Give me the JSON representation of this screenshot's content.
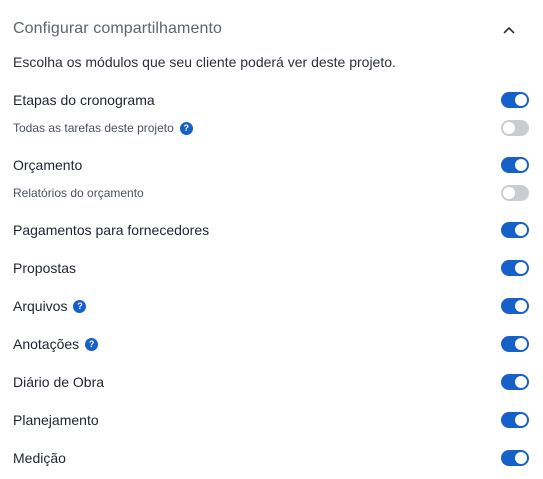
{
  "header": {
    "title": "Configurar compartilhamento",
    "collapse_icon": "chevron-up-icon"
  },
  "description": "Escolha os módulos que seu cliente poderá ver deste projeto.",
  "colors": {
    "toggle_on": "#1660c9",
    "toggle_off": "#c9ccd1",
    "help_icon": "#1660c9"
  },
  "modules": [
    {
      "label": "Etapas do cronograma",
      "enabled": true,
      "help": false,
      "level": "main"
    },
    {
      "label": "Todas as tarefas deste projeto",
      "enabled": false,
      "help": true,
      "level": "sub"
    },
    {
      "label": "Orçamento",
      "enabled": true,
      "help": false,
      "level": "main"
    },
    {
      "label": "Relatórios do orçamento",
      "enabled": false,
      "help": false,
      "level": "sub"
    },
    {
      "label": "Pagamentos para fornecedores",
      "enabled": true,
      "help": false,
      "level": "main"
    },
    {
      "label": "Propostas",
      "enabled": true,
      "help": false,
      "level": "main"
    },
    {
      "label": "Arquivos",
      "enabled": true,
      "help": true,
      "level": "main"
    },
    {
      "label": "Anotações",
      "enabled": true,
      "help": true,
      "level": "main"
    },
    {
      "label": "Diário de Obra",
      "enabled": true,
      "help": false,
      "level": "main"
    },
    {
      "label": "Planejamento",
      "enabled": true,
      "help": false,
      "level": "main"
    },
    {
      "label": "Medição",
      "enabled": true,
      "help": false,
      "level": "main"
    }
  ]
}
